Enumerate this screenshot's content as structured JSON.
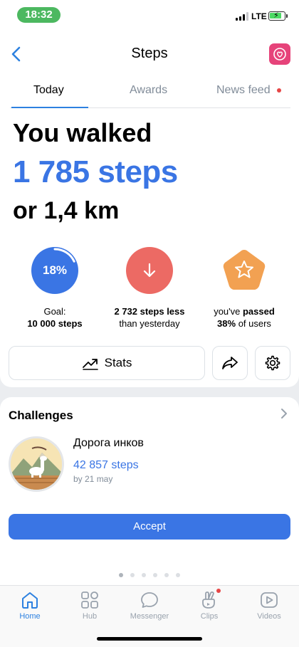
{
  "status_bar": {
    "time": "18:32",
    "network": "LTE"
  },
  "header": {
    "title": "Steps",
    "back_icon": "chevron-left-icon",
    "action_icon": "heart-icon"
  },
  "tabs": [
    {
      "label": "Today",
      "active": true
    },
    {
      "label": "Awards",
      "active": false
    },
    {
      "label": "News feed",
      "active": false,
      "badge": true
    }
  ],
  "summary": {
    "line1": "You walked",
    "steps": "1 785 steps",
    "distance": "or 1,4 km"
  },
  "stats": {
    "goal": {
      "value_label": "18%",
      "progress": 0.18,
      "caption_top": "Goal:",
      "caption_bold": "10 000 steps",
      "color": "#3a75e4"
    },
    "comparison": {
      "caption_bold": "2 732 steps less",
      "caption_bottom": "than yesterday",
      "icon": "arrow-down-icon",
      "color": "#ec6a64"
    },
    "rank": {
      "caption_top": "you've ",
      "caption_bold_top": "passed",
      "caption_bold": "38%",
      "caption_bottom": " of users",
      "icon": "star-icon",
      "color": "#f2a152"
    }
  },
  "actions": {
    "stats_label": "Stats",
    "share_icon": "share-icon",
    "settings_icon": "gear-icon"
  },
  "challenges": {
    "title": "Challenges",
    "item": {
      "name": "Дорога инков",
      "steps": "42 857 steps",
      "deadline": "by 21 may"
    },
    "accept_label": "Accept",
    "page_count": 6,
    "current_page": 0
  },
  "nav": [
    {
      "label": "Home",
      "icon": "home-icon",
      "active": true
    },
    {
      "label": "Hub",
      "icon": "grid-icon",
      "active": false
    },
    {
      "label": "Messenger",
      "icon": "chat-icon",
      "active": false
    },
    {
      "label": "Clips",
      "icon": "clips-icon",
      "active": false,
      "badge": true
    },
    {
      "label": "Videos",
      "icon": "video-icon",
      "active": false
    }
  ],
  "colors": {
    "accent": "#3a75e4",
    "badge_red": "#e64646",
    "heart_pink": "#e6437a"
  }
}
